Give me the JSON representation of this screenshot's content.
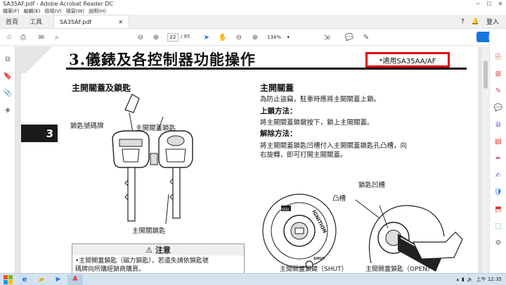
{
  "window": {
    "title": "SA35AF.pdf - Adobe Acrobat Reader DC"
  },
  "menu": [
    "檔案(F)",
    "編輯(E)",
    "檢視(V)",
    "視窗(W)",
    "說明(H)"
  ],
  "tabs": {
    "home": "首頁",
    "tools": "工具",
    "document": "SA35AF.pdf"
  },
  "account": {
    "signin": "登入"
  },
  "toolbar": {
    "page_current": "22",
    "page_total": "/ 85",
    "zoom": "134%",
    "share": "共用"
  },
  "page": {
    "title": "3.儀錶及各控制器功能操作",
    "model_note": "*適用SA35AA/AF",
    "chapter_number": "3",
    "left_section": "主開關蓋及鎖匙",
    "label_key_tag": "鎖匙號碼牌",
    "label_cover_key": "主開關蓋鎖匙",
    "label_main_key": "主開關鎖匙",
    "caution_title": "注意",
    "caution_line1": "•主開關蓋鎖匙（磁力鎖匙），若遺失請依鎖匙號",
    "caution_line2": "碼牌向所購經銷商購買。",
    "right_section": "主開關蓋",
    "intro": "為防止盜竊，駐車時應將主開關蓋上鎖。",
    "lock_heading": "上鎖方法：",
    "lock_text": "將主開關蓋鎖鍵按下，鎖上主開關蓋。",
    "unlock_heading": "解除方法：",
    "unlock_text_1": "將主開關蓋鎖匙凹槽付入主開關蓋鎖匙孔凸槽，向",
    "unlock_text_2": "右旋轉，即可打開主開關蓋。",
    "label_key_groove": "鎖匙凹槽",
    "label_bump": "凸槽",
    "label_push": "PUSH",
    "label_ignition": "IGNITION",
    "label_shut": "SHUT",
    "caption_shut": "主開關蓋鎖鍵（SHUT）",
    "caption_open": "主開關蓋鎖匙（OPEN）"
  },
  "taskbar": {
    "time": "上午 12:35"
  }
}
